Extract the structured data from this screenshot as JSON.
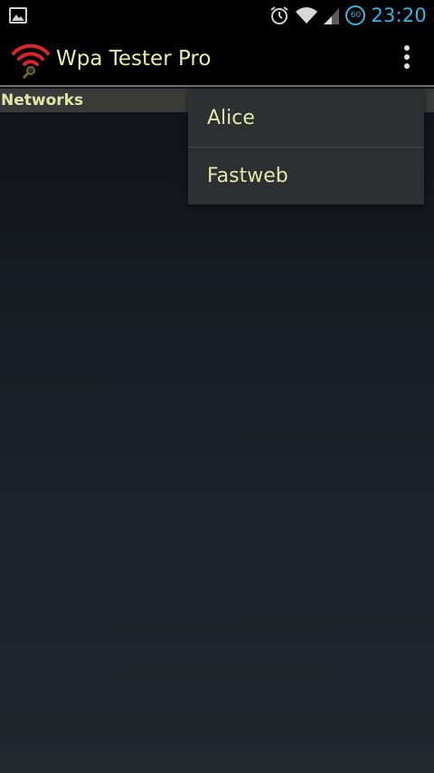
{
  "status_bar": {
    "time": "23:20",
    "battery": "60",
    "icons": [
      "gallery-icon",
      "alarm-icon",
      "wifi-icon",
      "signal-icon",
      "battery-icon"
    ]
  },
  "action_bar": {
    "title": "Wpa Tester Pro",
    "icons": [
      "app-logo-icon",
      "overflow-menu-icon"
    ]
  },
  "section": {
    "label": "Networks"
  },
  "menu": {
    "items": [
      {
        "label": "Alice"
      },
      {
        "label": "Fastweb"
      }
    ]
  },
  "colors": {
    "accent_text": "#e2e6a8",
    "status_blue": "#33b5e5",
    "logo_red": "#d9252a"
  }
}
